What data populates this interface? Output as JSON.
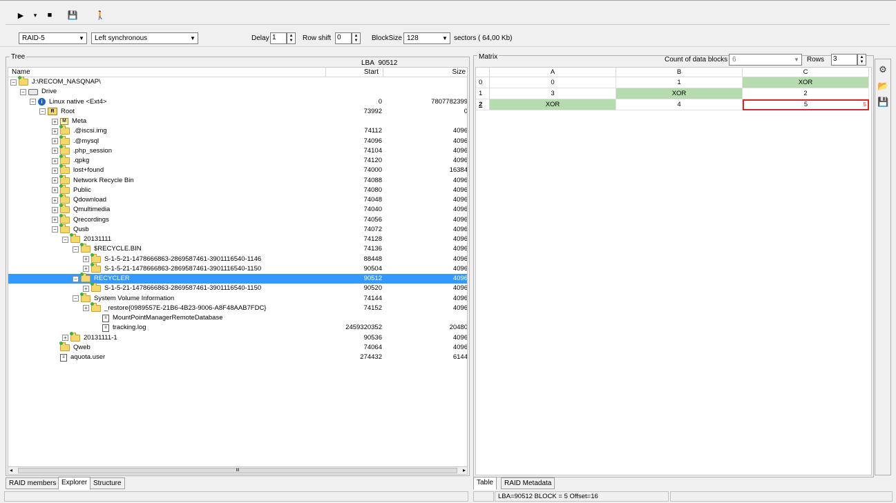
{
  "toolbar": {
    "play_glyph": "▶",
    "dropdown_glyph": "▾",
    "stop_glyph": "■",
    "save_glyph": "💾",
    "walker_glyph": "🚶"
  },
  "settings": {
    "raid_type": "RAID-5",
    "layout": "Left synchronous",
    "delay_label": "Delay",
    "delay_value": "1",
    "row_shift_label": "Row shift",
    "row_shift_value": "0",
    "block_size_label": "BlockSize",
    "block_size_value": "128",
    "sectors_label": "sectors ( 64,00 Kb)"
  },
  "tree": {
    "group_title": "Tree",
    "lba_label": "LBA",
    "lba_value": "90512",
    "columns": {
      "name": "Name",
      "start": "Start",
      "size": "Size"
    },
    "rows": [
      {
        "name": "J:\\RECOM_NASQNAP\\",
        "start": "",
        "size": "",
        "icon": "folder",
        "expander": "minus"
      },
      {
        "name": "Drive",
        "start": "",
        "size": "",
        "icon": "drive",
        "expander": "minus"
      },
      {
        "name": "Linux native <Ext4>",
        "start": "0",
        "size": "7807782399",
        "icon": "info",
        "expander": "minus"
      },
      {
        "name": "Root",
        "start": "73992",
        "size": "0",
        "icon": "root",
        "expander": "minus"
      },
      {
        "name": "Meta",
        "start": "",
        "size": "",
        "icon": "meta",
        "expander": "plus"
      },
      {
        "name": ".@iscsi.img",
        "start": "74112",
        "size": "4096",
        "icon": "folder",
        "expander": "plus"
      },
      {
        "name": ".@mysql",
        "start": "74096",
        "size": "4096",
        "icon": "folder",
        "expander": "plus"
      },
      {
        "name": ".php_session",
        "start": "74104",
        "size": "4096",
        "icon": "folder",
        "expander": "plus"
      },
      {
        "name": ".qpkg",
        "start": "74120",
        "size": "4096",
        "icon": "folder",
        "expander": "plus"
      },
      {
        "name": "lost+found",
        "start": "74000",
        "size": "16384",
        "icon": "folder",
        "expander": "plus"
      },
      {
        "name": "Network Recycle Bin",
        "start": "74088",
        "size": "4096",
        "icon": "folder",
        "expander": "plus"
      },
      {
        "name": "Public",
        "start": "74080",
        "size": "4096",
        "icon": "folder",
        "expander": "plus"
      },
      {
        "name": "Qdownload",
        "start": "74048",
        "size": "4096",
        "icon": "folder",
        "expander": "plus"
      },
      {
        "name": "Qmultimedia",
        "start": "74040",
        "size": "4096",
        "icon": "folder",
        "expander": "plus"
      },
      {
        "name": "Qrecordings",
        "start": "74056",
        "size": "4096",
        "icon": "folder",
        "expander": "plus"
      },
      {
        "name": "Qusb",
        "start": "74072",
        "size": "4096",
        "icon": "folder",
        "expander": "minus"
      },
      {
        "name": "20131111",
        "start": "74128",
        "size": "4096",
        "icon": "folder",
        "expander": "minus"
      },
      {
        "name": "$RECYCLE.BIN",
        "start": "74136",
        "size": "4096",
        "icon": "folder",
        "expander": "minus"
      },
      {
        "name": "S-1-5-21-1478666863-2869587461-3901116540-1146",
        "start": "88448",
        "size": "4096",
        "icon": "folder",
        "expander": "plus"
      },
      {
        "name": "S-1-5-21-1478666863-2869587461-3901116540-1150",
        "start": "90504",
        "size": "4096",
        "icon": "folder",
        "expander": "plus"
      },
      {
        "name": "RECYCLER",
        "start": "90512",
        "size": "4096",
        "icon": "folder",
        "expander": "minus",
        "selected": true
      },
      {
        "name": "S-1-5-21-1478666863-2869587461-3901116540-1150",
        "start": "90520",
        "size": "4096",
        "icon": "folder",
        "expander": "plus"
      },
      {
        "name": "System Volume Information",
        "start": "74144",
        "size": "4096",
        "icon": "folder",
        "expander": "minus"
      },
      {
        "name": "_restore{0989557E-21B6-4B23-9006-A8F48AAB7FDC}",
        "start": "74152",
        "size": "4096",
        "icon": "folder",
        "expander": "plus"
      },
      {
        "name": "MountPointManagerRemoteDatabase",
        "start": "",
        "size": "",
        "icon": "file",
        "expander": "none"
      },
      {
        "name": "tracking.log",
        "start": "2459320352",
        "size": "20480",
        "icon": "file",
        "expander": "none"
      },
      {
        "name": "20131111-1",
        "start": "90536",
        "size": "4096",
        "icon": "folder",
        "expander": "plus"
      },
      {
        "name": "Qweb",
        "start": "74064",
        "size": "4096",
        "icon": "folder",
        "expander": "none"
      },
      {
        "name": "aquota.user",
        "start": "274432",
        "size": "6144",
        "icon": "file",
        "expander": "none"
      }
    ],
    "hscroll_thumb": "III"
  },
  "left_tabs": [
    "RAID members",
    "Explorer",
    "Structure"
  ],
  "matrix": {
    "group_title": "Matrix",
    "count_label": "Count of data blocks",
    "count_value": "6",
    "rows_label": "Rows",
    "rows_value": "3",
    "columns": [
      "A",
      "B",
      "C"
    ],
    "rows": [
      {
        "index": "0",
        "cells": [
          "0",
          "1",
          "XOR"
        ]
      },
      {
        "index": "1",
        "cells": [
          "3",
          "XOR",
          "2"
        ]
      },
      {
        "index": "2",
        "cells": [
          "XOR",
          "4",
          "5"
        ]
      }
    ],
    "selected_cell_corner": "5"
  },
  "right_tabs": [
    "Table",
    "RAID Metadata"
  ],
  "side_tools": [
    "settings-icon",
    "open-icon",
    "save-icon"
  ],
  "status": {
    "left": "",
    "info": "LBA=90512 BLOCK = 5 Offset=16",
    "right": ""
  },
  "colors": {
    "selection": "#3399ff",
    "xor_cell": "#b5dbae",
    "selected_cell_border": "#d62828"
  }
}
